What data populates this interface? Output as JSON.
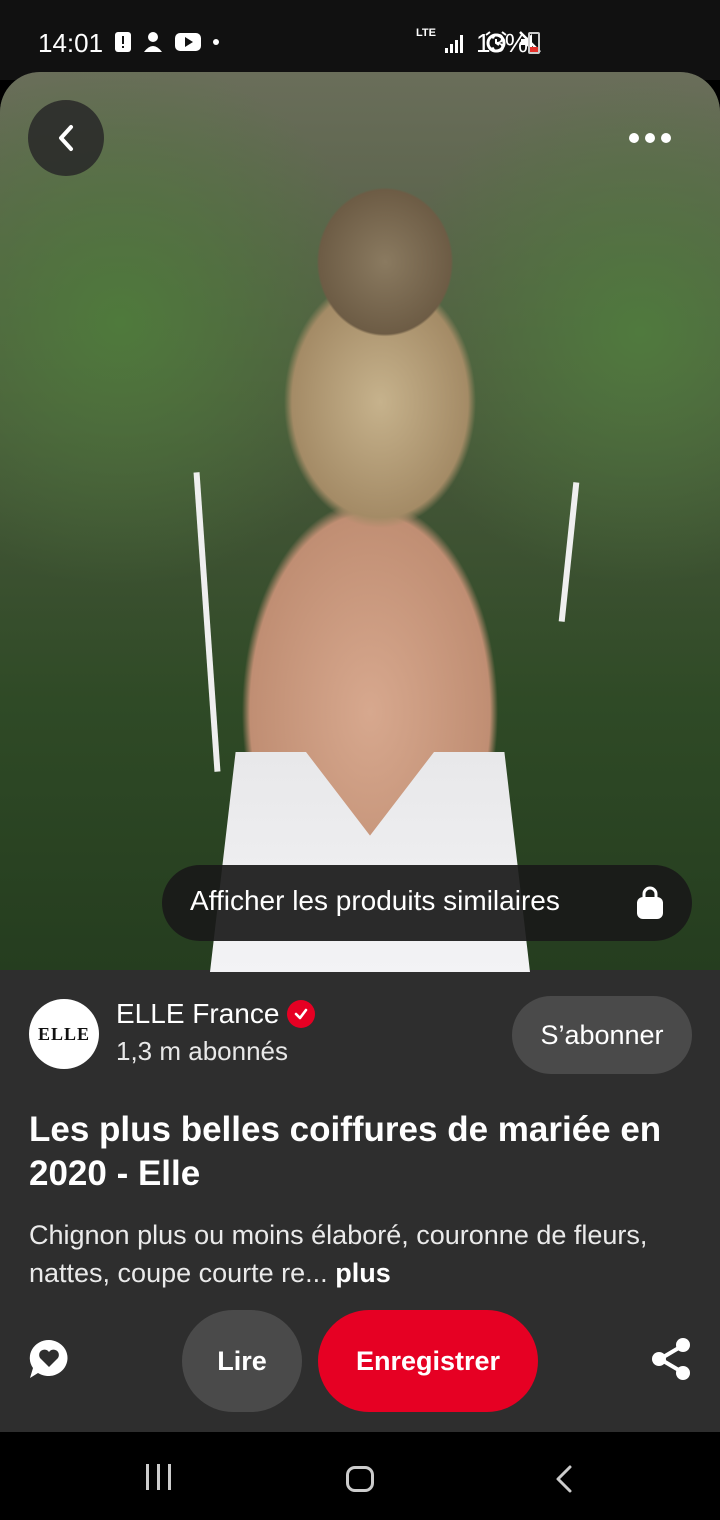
{
  "status_bar": {
    "time": "14:01",
    "network": "LTE",
    "battery": "13%",
    "battery_color": "#e5312b",
    "icons": [
      "alert-icon",
      "account-icon",
      "youtube-icon",
      "dot-icon",
      "alarm-icon",
      "mute-icon",
      "signal-icon"
    ]
  },
  "pin": {
    "similar_products_label": "Afficher les produits similaires",
    "profile": {
      "avatar_text": "ELLE",
      "name": "ELLE France",
      "followers": "1,3 m abonnés",
      "follow_label": "S’abonner"
    },
    "title": "Les plus belles coiffures de mariée en 2020 - Elle",
    "description": "Chignon plus ou moins élaboré, couronne de fleurs, nattes, coupe courte re...",
    "more_label": "plus"
  },
  "actions": {
    "read_label": "Lire",
    "save_label": "Enregistrer",
    "accent_color": "#e60023"
  }
}
